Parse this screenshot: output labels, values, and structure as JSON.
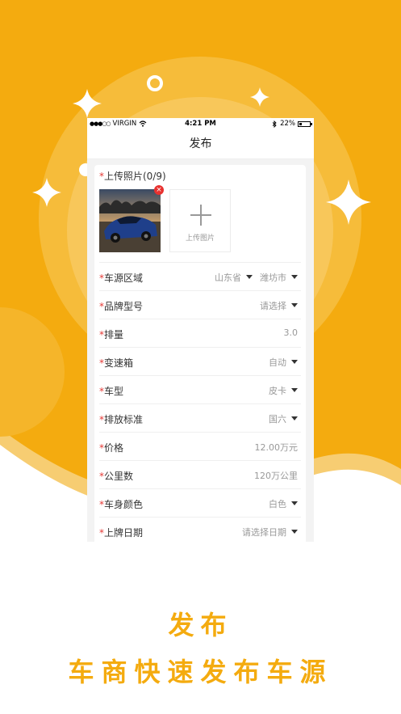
{
  "colors": {
    "brand": "#f4ab0f",
    "required": "#e53935",
    "badge": "#e8312f"
  },
  "statusbar": {
    "carrier": "VIRGIN",
    "time": "4:21 PM",
    "battery": "22%",
    "battery_level": 0.22
  },
  "navbar": {
    "title": "发布"
  },
  "photos": {
    "required_mark": "*",
    "title": "上传照片(0/9)",
    "delete_icon": "×",
    "upload_label": "上传图片"
  },
  "form": {
    "rows": [
      {
        "label": "车源区域",
        "value": "潍坊市",
        "value2": "山东省"
      },
      {
        "label": "品牌型号",
        "value": "请选择"
      },
      {
        "label": "排量",
        "value": "3.0"
      },
      {
        "label": "变速箱",
        "value": "自动"
      },
      {
        "label": "车型",
        "value": "皮卡"
      },
      {
        "label": "排放标准",
        "value": "国六"
      },
      {
        "label": "价格",
        "value": "12.00万元"
      },
      {
        "label": "公里数",
        "value": "120万公里"
      },
      {
        "label": "车身颜色",
        "value": "白色"
      },
      {
        "label": "上牌日期",
        "value": "请选择日期"
      }
    ]
  },
  "promo": {
    "headline": "发布",
    "tagline": "车商快速发布车源"
  }
}
